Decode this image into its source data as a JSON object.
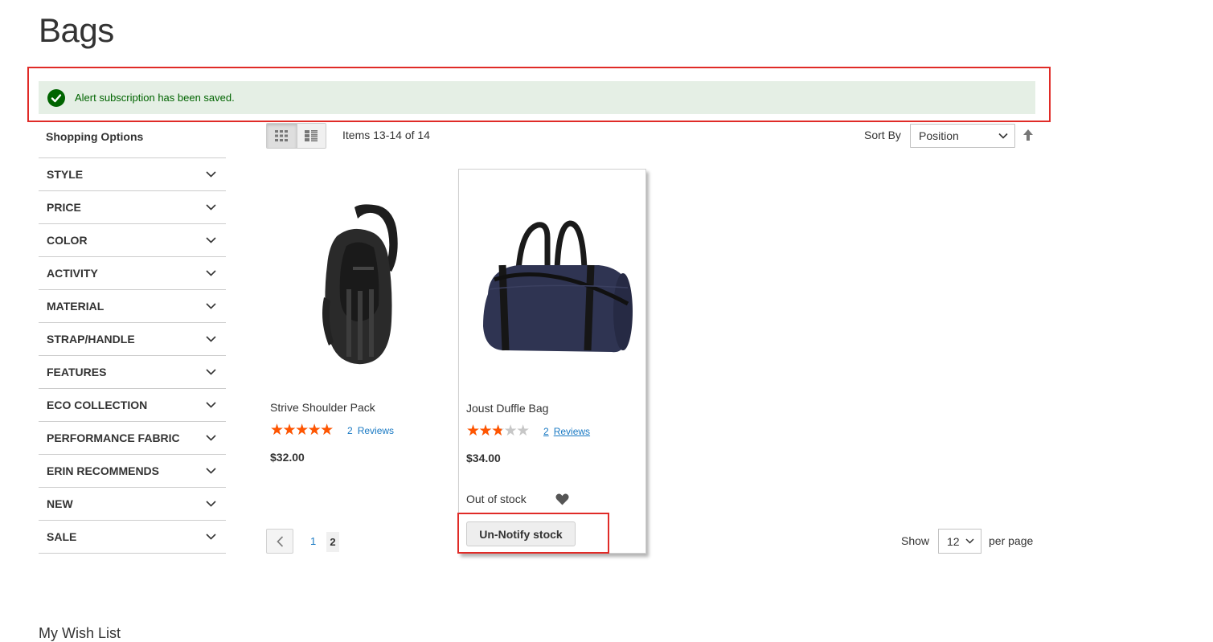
{
  "page": {
    "title": "Bags"
  },
  "message": {
    "text": "Alert subscription has been saved.",
    "type": "success"
  },
  "sidebar": {
    "title": "Shopping Options",
    "filters": [
      "STYLE",
      "PRICE",
      "COLOR",
      "ACTIVITY",
      "MATERIAL",
      "STRAP/HANDLE",
      "FEATURES",
      "ECO COLLECTION",
      "PERFORMANCE FABRIC",
      "ERIN RECOMMENDS",
      "NEW",
      "SALE"
    ]
  },
  "toolbar": {
    "modes": [
      "grid-icon",
      "list-icon"
    ],
    "amount": "Items 13-14 of 14",
    "sort_label": "Sort By",
    "sort_value": "Position"
  },
  "products": [
    {
      "name": "Strive Shoulder Pack",
      "rating_percent": 90,
      "reviews_count": "2",
      "reviews_label": "Reviews",
      "price": "$32.00"
    },
    {
      "name": "Joust Duffle Bag",
      "rating_percent": 50,
      "reviews_count": "2",
      "reviews_label": "Reviews",
      "price": "$34.00",
      "stock": "Out of stock",
      "button": "Un-Notify stock"
    }
  ],
  "pager": {
    "pages": [
      "1",
      "2"
    ],
    "current": "2"
  },
  "limiter": {
    "label": "Show",
    "value": "12",
    "suffix": "per page"
  },
  "footer": {
    "wishlist_title": "My Wish List"
  },
  "colors": {
    "accent": "#1979c3",
    "success": "#006400",
    "success_bg": "#e5efe5",
    "star": "#ff5501",
    "highlight": "#e02b27"
  }
}
